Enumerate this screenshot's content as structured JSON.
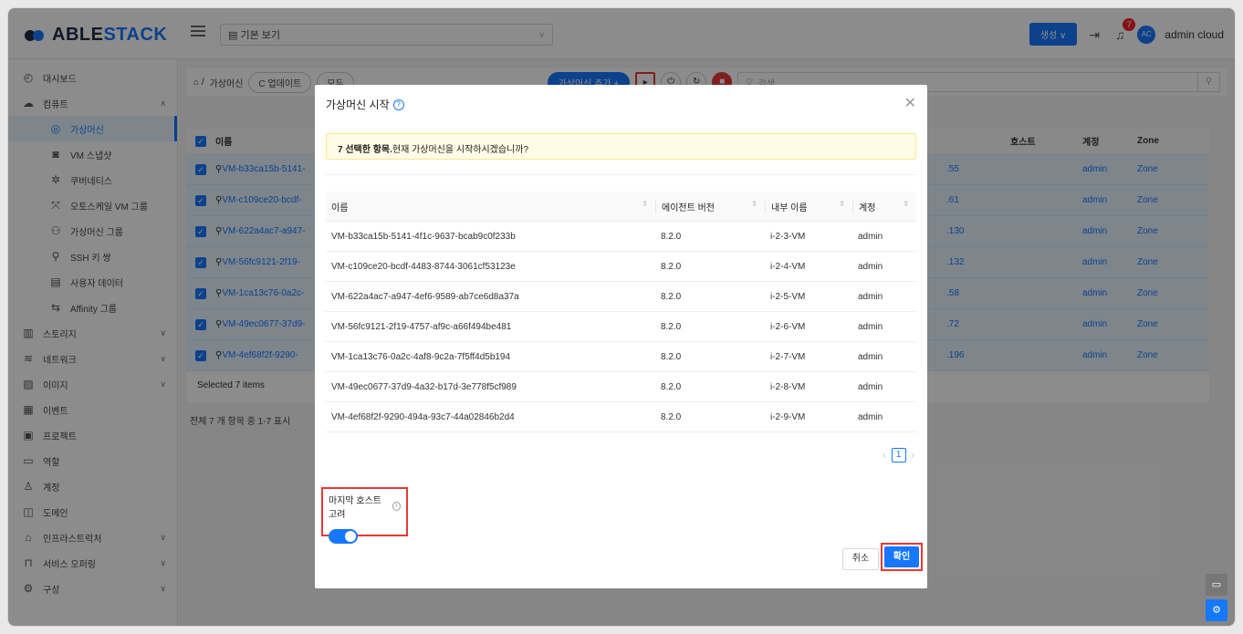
{
  "header": {
    "logo_prefix": "ABLE",
    "logo_suffix": "STACK",
    "view_select": "기본 보기",
    "create_label": "생성",
    "notif_count": "7",
    "avatar_initials": "AC",
    "user_name": "admin cloud"
  },
  "sidebar": {
    "items": [
      {
        "label": "대시보드",
        "icon": "dashboard-icon"
      },
      {
        "label": "컴퓨트",
        "icon": "cloud-icon"
      },
      {
        "label": "가상머신",
        "icon": "vm-icon"
      },
      {
        "label": "VM 스냅샷",
        "icon": "camera-icon"
      },
      {
        "label": "쿠버네티스",
        "icon": "kubernetes-icon"
      },
      {
        "label": "오토스케일 VM 그룹",
        "icon": "autoscale-icon"
      },
      {
        "label": "가상머신 그룹",
        "icon": "group-icon"
      },
      {
        "label": "SSH 키 쌍",
        "icon": "key-icon"
      },
      {
        "label": "사용자 데이터",
        "icon": "userdata-icon"
      },
      {
        "label": "Affinity 그룹",
        "icon": "affinity-icon"
      },
      {
        "label": "스토리지",
        "icon": "storage-icon"
      },
      {
        "label": "네트워크",
        "icon": "wifi-icon"
      },
      {
        "label": "이미지",
        "icon": "image-icon"
      },
      {
        "label": "이벤트",
        "icon": "calendar-icon"
      },
      {
        "label": "프로젝트",
        "icon": "project-icon"
      },
      {
        "label": "역할",
        "icon": "role-icon"
      },
      {
        "label": "계정",
        "icon": "account-icon"
      },
      {
        "label": "도메인",
        "icon": "domain-icon"
      },
      {
        "label": "인프라스트럭처",
        "icon": "infra-icon"
      },
      {
        "label": "서비스 오퍼링",
        "icon": "offering-icon"
      },
      {
        "label": "구성",
        "icon": "settings-icon"
      }
    ]
  },
  "toolbar": {
    "breadcrumb": "가상머신",
    "refresh": "업데이트",
    "filter": "모두",
    "add_vm": "가상머신 추가",
    "search_placeholder": "검색"
  },
  "list": {
    "col_name": "이름",
    "col_host": "호스트",
    "col_account": "계정",
    "col_zone": "Zone",
    "rows": [
      {
        "name": "VM-b33ca15b-5141-",
        "ip": ".55",
        "account": "admin",
        "zone": "Zone"
      },
      {
        "name": "VM-c109ce20-bcdf-",
        "ip": ".61",
        "account": "admin",
        "zone": "Zone"
      },
      {
        "name": "VM-622a4ac7-a947-",
        "ip": ".130",
        "account": "admin",
        "zone": "Zone"
      },
      {
        "name": "VM-56fc9121-2f19-",
        "ip": ".132",
        "account": "admin",
        "zone": "Zone"
      },
      {
        "name": "VM-1ca13c76-0a2c-",
        "ip": ".58",
        "account": "admin",
        "zone": "Zone"
      },
      {
        "name": "VM-49ec0677-37d9-",
        "ip": ".72",
        "account": "admin",
        "zone": "Zone"
      },
      {
        "name": "VM-4ef68f2f-9290-",
        "ip": ".196",
        "account": "admin",
        "zone": "Zone"
      }
    ],
    "selected": "Selected 7 items",
    "pagination": "전체 7 개 항목 중 1-7 표시"
  },
  "modal": {
    "title": "가상머신 시작",
    "alert_bold": "7 선택한 항목.",
    "alert_text": "현재 가상머신을 시작하시겠습니까?",
    "headers": {
      "name": "이름",
      "agent": "에이전트 버전",
      "internal": "내부 이름",
      "account": "계정"
    },
    "rows": [
      {
        "name": "VM-b33ca15b-5141-4f1c-9637-bcab9c0f233b",
        "agent": "8.2.0",
        "internal": "i-2-3-VM",
        "account": "admin"
      },
      {
        "name": "VM-c109ce20-bcdf-4483-8744-3061cf53123e",
        "agent": "8.2.0",
        "internal": "i-2-4-VM",
        "account": "admin"
      },
      {
        "name": "VM-622a4ac7-a947-4ef6-9589-ab7ce6d8a37a",
        "agent": "8.2.0",
        "internal": "i-2-5-VM",
        "account": "admin"
      },
      {
        "name": "VM-56fc9121-2f19-4757-af9c-a66f494be481",
        "agent": "8.2.0",
        "internal": "i-2-6-VM",
        "account": "admin"
      },
      {
        "name": "VM-1ca13c76-0a2c-4af8-9c2a-7f5ff4d5b194",
        "agent": "8.2.0",
        "internal": "i-2-7-VM",
        "account": "admin"
      },
      {
        "name": "VM-49ec0677-37d9-4a32-b17d-3e778f5cf989",
        "agent": "8.2.0",
        "internal": "i-2-8-VM",
        "account": "admin"
      },
      {
        "name": "VM-4ef68f2f-9290-494a-93c7-44a02846b2d4",
        "agent": "8.2.0",
        "internal": "i-2-9-VM",
        "account": "admin"
      }
    ],
    "page": "1",
    "option_label": "마지막 호스트 고려",
    "option_on": true,
    "cancel": "취소",
    "ok": "확인"
  },
  "colors": {
    "accent": "#1677ff",
    "highlight": "#e53935"
  }
}
